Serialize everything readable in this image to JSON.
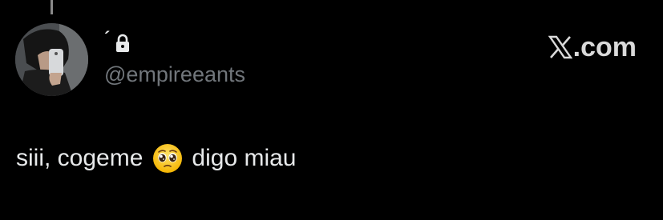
{
  "tweet": {
    "author": {
      "display_name": "´",
      "handle": "@empireeants",
      "avatar_icon": "profile-photo-mirror-selfie",
      "protected_icon": "lock-icon"
    },
    "brand": {
      "logo_icon": "x-logo-icon",
      "suffix": ".com"
    },
    "text_before": "siii, cogeme",
    "emoji": "pleading-face-emoji",
    "text_after": "digo miau"
  },
  "colors": {
    "background": "#000000",
    "primary_text": "#e7e9ea",
    "secondary_text": "#71767b"
  }
}
